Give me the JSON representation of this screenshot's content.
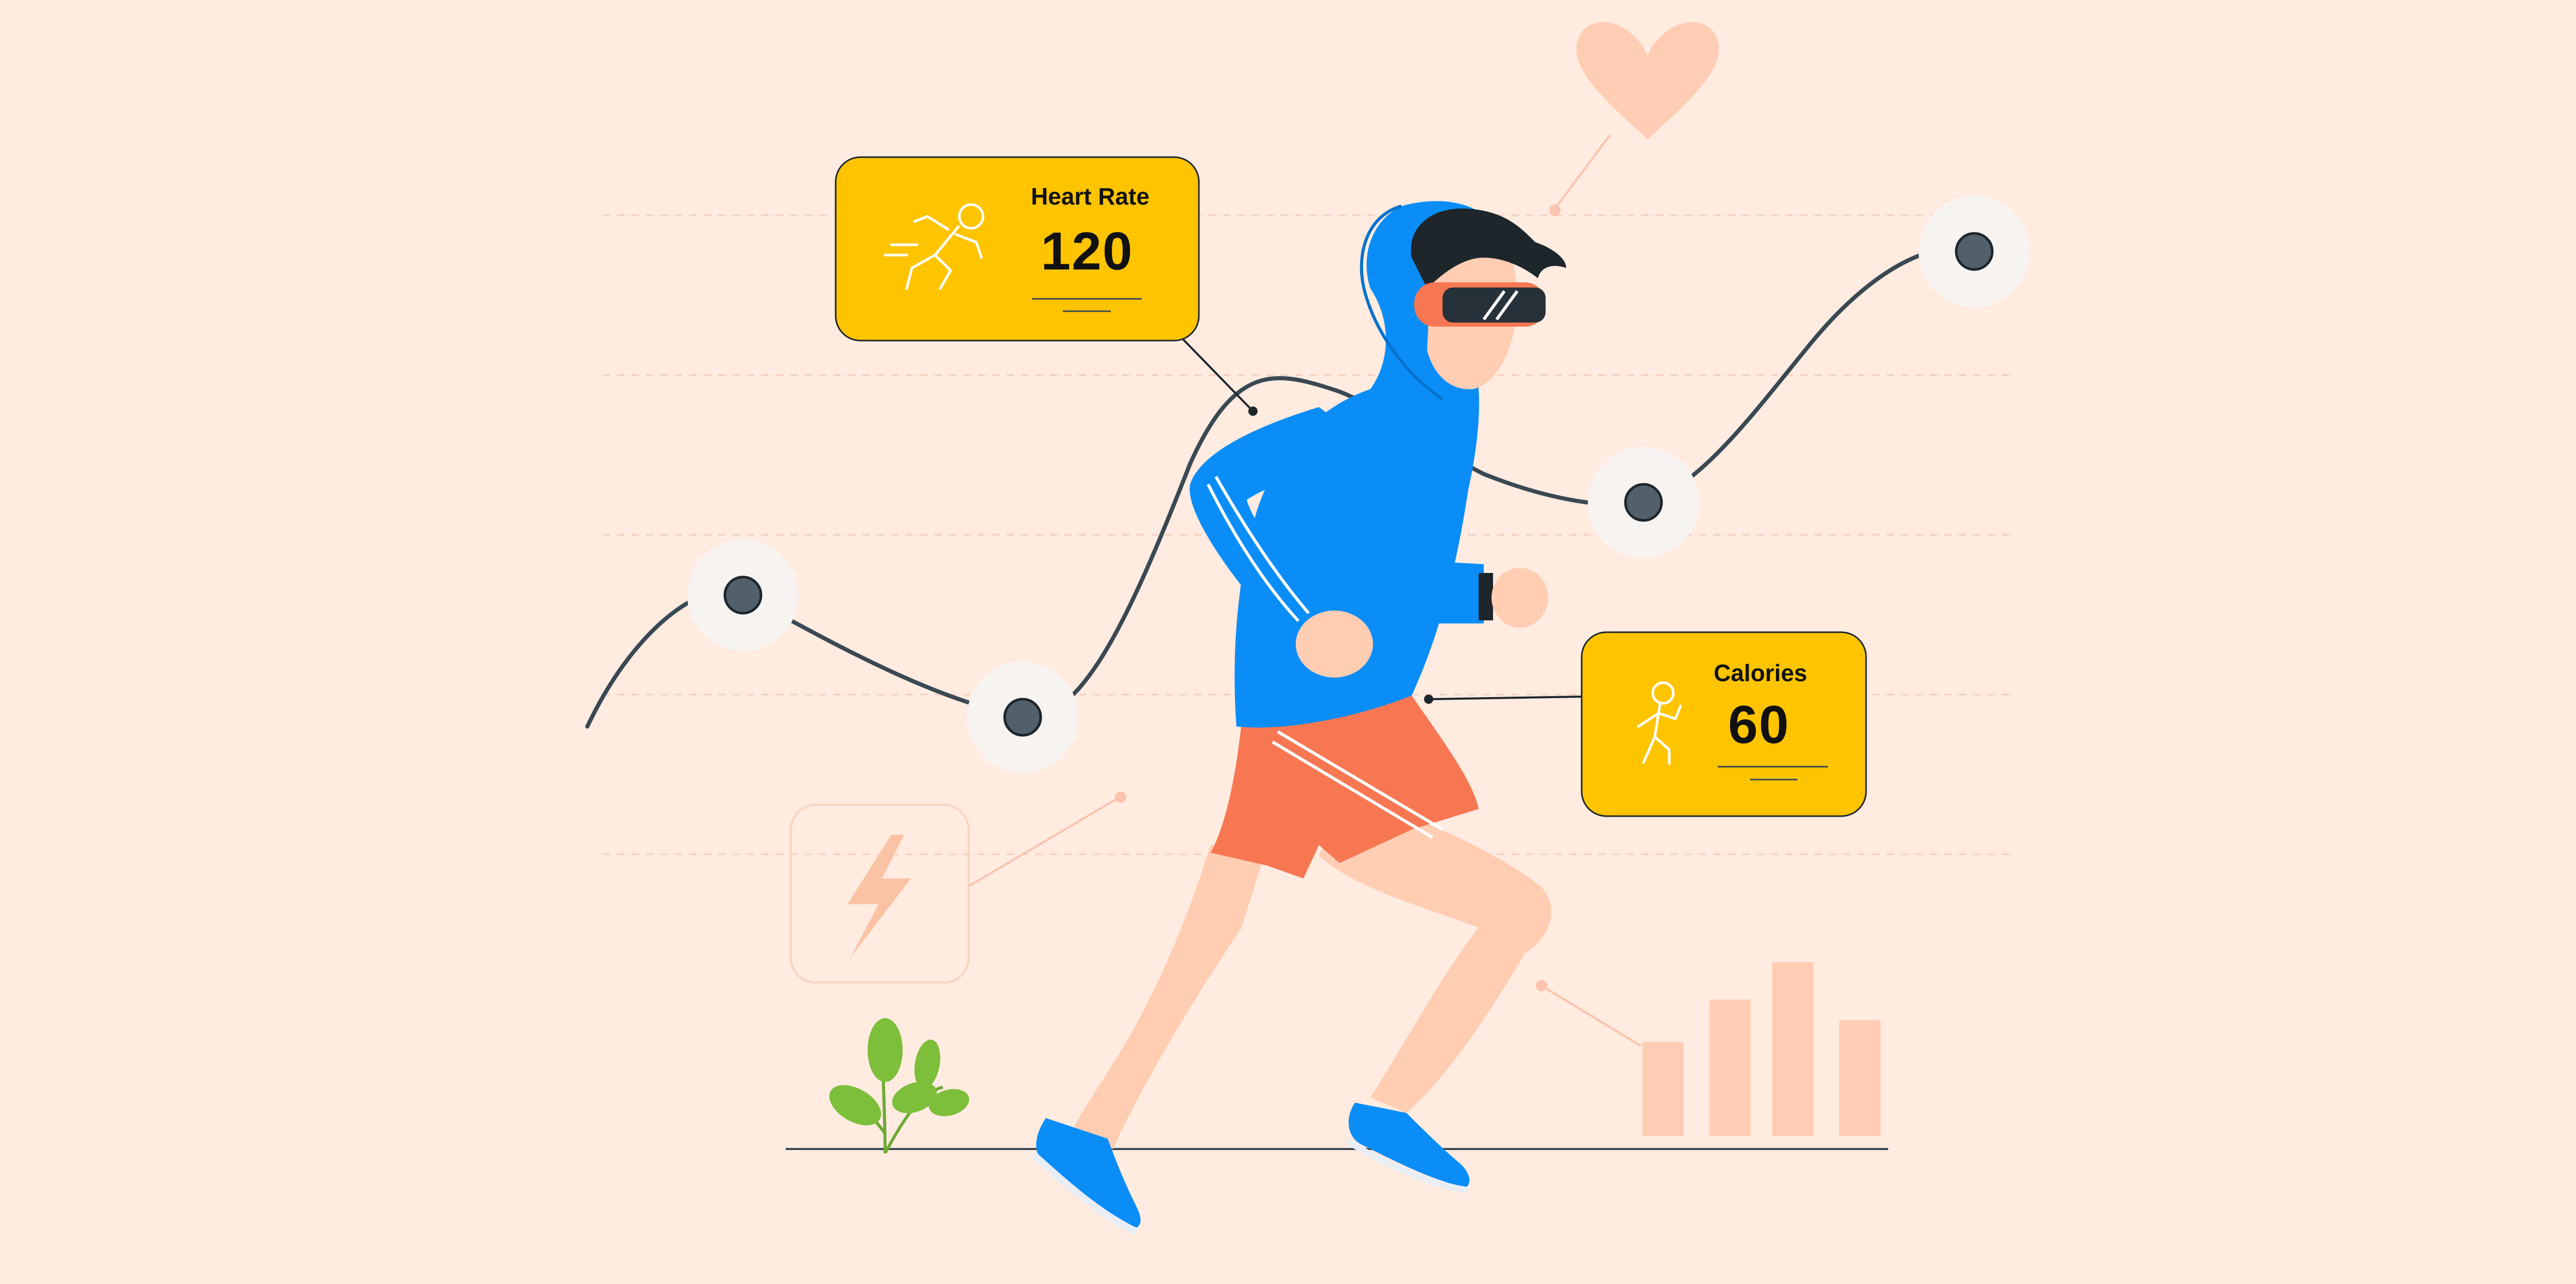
{
  "colors": {
    "background": "#FFEBE0",
    "card_fill": "#FFC400",
    "hoodie": "#0A8DF7",
    "shorts": "#F77752",
    "skin": "#FFCDB2",
    "heart": "#FFCCB4",
    "line": "#3A4852",
    "plant": "#7DBE3B"
  },
  "cards": {
    "heart_rate": {
      "label": "Heart Rate",
      "value": "120",
      "icon": "running-person-icon"
    },
    "calories": {
      "label": "Calories",
      "value": "60",
      "icon": "walking-person-icon"
    }
  },
  "decor": {
    "heart": "heart-icon",
    "energy": "lightning-bolt-icon",
    "bars": "bar-chart-icon"
  }
}
